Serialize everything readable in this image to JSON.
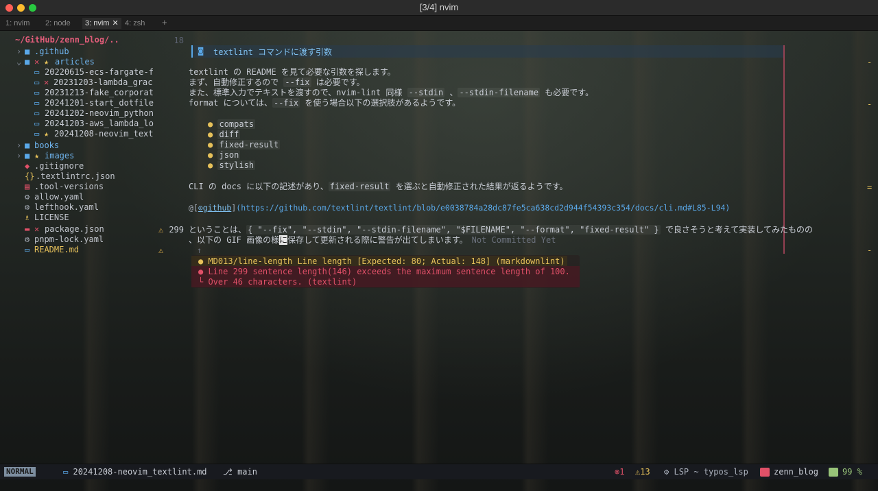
{
  "window": {
    "title": "[3/4] nvim"
  },
  "tabs": [
    {
      "label": "1: nvim"
    },
    {
      "label": "2: node"
    },
    {
      "label": "3: nvim",
      "close": "✕"
    },
    {
      "label": "4: zsh"
    }
  ],
  "tabs_plus": "+",
  "sidebar": {
    "root": "~/GitHub/zenn_blog/..",
    "items": [
      {
        "label": ".github"
      },
      {
        "label": "articles"
      },
      {
        "label": "20220615-ecs-fargate-f"
      },
      {
        "label": "20231203-lambda_grac"
      },
      {
        "label": "20231213-fake_corporat"
      },
      {
        "label": "20241201-start_dotfile"
      },
      {
        "label": "20241202-neovim_python"
      },
      {
        "label": "20241203-aws_lambda_lo"
      },
      {
        "label": "20241208-neovim_text"
      },
      {
        "label": "books"
      },
      {
        "label": "images"
      },
      {
        "label": ".gitignore"
      },
      {
        "label": ".textlintrc.json"
      },
      {
        "label": ".tool-versions"
      },
      {
        "label": "allow.yaml"
      },
      {
        "label": "lefthook.yaml"
      },
      {
        "label": "LICENSE"
      },
      {
        "label": "package.json"
      },
      {
        "label": "pnpm-lock.yaml"
      },
      {
        "label": "README.md"
      }
    ]
  },
  "gutter": {
    "line_18": "18",
    "line_299": "299"
  },
  "editor": {
    "heading": "textlint コマンドに渡す引数",
    "p1": "textlint の README を見て必要な引数を探します。",
    "p2a": "まず、自動修正するので ",
    "p2code": "--fix",
    "p2b": " は必要です。",
    "p3a": "また、標準入力でテキストを渡すので、nvim-lint 同様 ",
    "p3code1": "--stdin",
    "p3mid": " 、",
    "p3code2": "--stdin-filename",
    "p3b": " も必要です。",
    "p4a": "format については、",
    "p4code": "--fix",
    "p4b": " を使う場合以下の選択肢があるようです。",
    "list": [
      "compats",
      "diff",
      "fixed-result",
      "json",
      "stylish"
    ],
    "p5a": "CLI の docs に以下の記述があり、",
    "p5code": "fixed-result",
    "p5b": " を選ぶと自動修正された結果が返るようです。",
    "link_at": "@[",
    "link_text": "github",
    "link_close": "]",
    "link_url": "(https://github.com/textlint/textlint/blob/e0038784a28dc87fe5ca638cd2d944f54393c354/docs/cli.md#L85-L94)",
    "l299a": "ということは、",
    "l299code": "{ \"--fix\", \"--stdin\", \"--stdin-filename\", \"$FILENAME\", \"--format\", \"fixed-result\" }",
    "l299b": " で良さそうと考えて実装してみたものの",
    "l300a": "、以下の GIF 画像の様",
    "l300cursor": "に",
    "l300b": "保存して更新される際に警告が出てしまいます。",
    "blame": "Not Committed Yet",
    "arrow": "↑",
    "diag_warn": "● MD013/line-length Line length [Expected: 80; Actual: 148] (markdownlint)",
    "diag_err1": "● Line 299 sentence length(146) exceeds the maximum sentence length of 100.",
    "diag_err2": "└ Over 46 characters. (textlint)"
  },
  "status": {
    "mode": "NORMAL",
    "file": "20241208-neovim_textlint.md",
    "branch": "main",
    "errors": "1",
    "warnings": "13",
    "lsp": "LSP ~ typos_lsp",
    "project": "zenn_blog",
    "percent": "99 %"
  },
  "colors": {
    "accent_blue": "#5aa8e8",
    "error": "#e05068",
    "warning": "#e6c15a",
    "ok": "#98c379"
  }
}
